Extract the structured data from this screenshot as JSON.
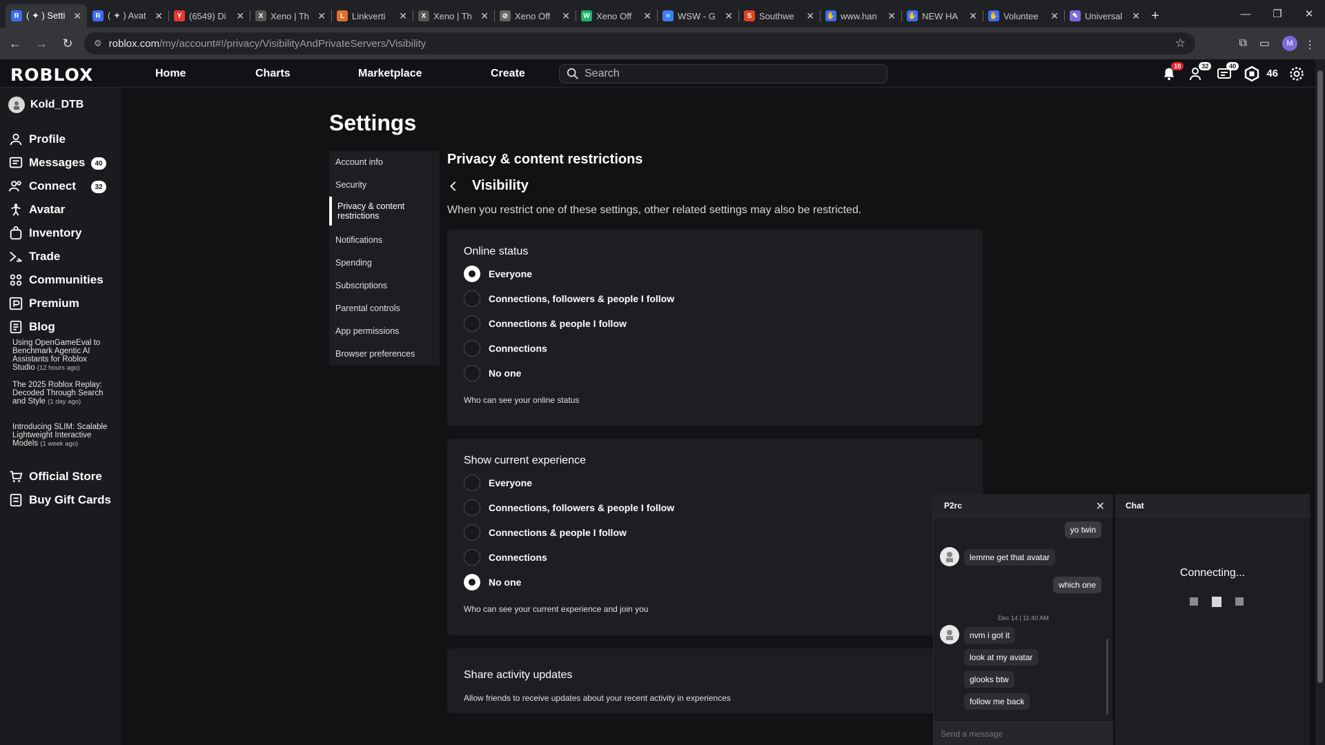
{
  "browser": {
    "tabs": [
      {
        "title": "( ✦ ) Setti",
        "color": "#3b6ef5",
        "glyph": "R"
      },
      {
        "title": "( ✦ ) Avat",
        "color": "#3b6ef5",
        "glyph": "R"
      },
      {
        "title": "(6549) Di",
        "color": "#e53935",
        "glyph": "Y"
      },
      {
        "title": "Xeno | Th",
        "color": "#555555",
        "glyph": "X"
      },
      {
        "title": "Linkverti",
        "color": "#e0702a",
        "glyph": "L"
      },
      {
        "title": "Xeno | Th",
        "color": "#555555",
        "glyph": "X"
      },
      {
        "title": "Xeno Off",
        "color": "#666666",
        "glyph": "⊘"
      },
      {
        "title": "Xeno Off",
        "color": "#20b26b",
        "glyph": "W"
      },
      {
        "title": "WSW - G",
        "color": "#3d7ef0",
        "glyph": "≡"
      },
      {
        "title": "Southwe",
        "color": "#e2431e",
        "glyph": "S"
      },
      {
        "title": "www.han",
        "color": "#3b6ef5",
        "glyph": "✋"
      },
      {
        "title": "NEW HA",
        "color": "#3b6ef5",
        "glyph": "✋"
      },
      {
        "title": "Voluntee",
        "color": "#3b6ef5",
        "glyph": "✋"
      },
      {
        "title": "Universal",
        "color": "#7d6bd8",
        "glyph": "✎"
      }
    ],
    "url_host": "roblox.com",
    "url_path": "/my/account#!/privacy/VisibilityAndPrivateServers/Visibility",
    "profile_initial": "M"
  },
  "header": {
    "logo": "ROBLOX",
    "nav": [
      "Home",
      "Charts",
      "Marketplace",
      "Create"
    ],
    "search_placeholder": "Search",
    "notifications": "10",
    "friends": "32",
    "messages": "40",
    "robux": "46"
  },
  "sidebar": {
    "username": "Kold_DTB",
    "items": [
      {
        "label": "Profile",
        "icon": "person-icon"
      },
      {
        "label": "Messages",
        "icon": "message-icon",
        "badge": "40"
      },
      {
        "label": "Connect",
        "icon": "people-icon",
        "badge": "32"
      },
      {
        "label": "Avatar",
        "icon": "avatar-icon"
      },
      {
        "label": "Inventory",
        "icon": "bag-icon"
      },
      {
        "label": "Trade",
        "icon": "trade-icon"
      },
      {
        "label": "Communities",
        "icon": "communities-icon"
      },
      {
        "label": "Premium",
        "icon": "premium-icon"
      },
      {
        "label": "Blog",
        "icon": "blog-icon"
      }
    ],
    "blog_posts": [
      {
        "title": "Using OpenGameEval to Benchmark Agentic AI Assistants for Roblox Studio",
        "age": "(12 hours ago)"
      },
      {
        "title": "The 2025 Roblox Replay: Decoded Through Search and Style",
        "age": "(1 day ago)"
      },
      {
        "title": "Introducing SLIM: Scalable Lightweight Interactive Models",
        "age": "(1 week ago)"
      }
    ],
    "store": "Official Store",
    "giftcards": "Buy Gift Cards"
  },
  "settings": {
    "title": "Settings",
    "nav": [
      "Account info",
      "Security",
      "Privacy & content restrictions",
      "Notifications",
      "Spending",
      "Subscriptions",
      "Parental controls",
      "App permissions",
      "Browser preferences"
    ],
    "section_title": "Privacy & content restrictions",
    "subsection": "Visibility",
    "description": "When you restrict one of these settings, other related settings may also be restricted.",
    "online": {
      "title": "Online status",
      "options": [
        "Everyone",
        "Connections, followers & people I follow",
        "Connections & people I follow",
        "Connections",
        "No one"
      ],
      "hint": "Who can see your online status"
    },
    "experience": {
      "title": "Show current experience",
      "options": [
        "Everyone",
        "Connections, followers & people I follow",
        "Connections & people I follow",
        "Connections",
        "No one"
      ],
      "hint": "Who can see your current experience and join you"
    },
    "activity": {
      "title": "Share activity updates",
      "hint": "Allow friends to receive updates about your recent activity in experiences"
    }
  },
  "chat": {
    "contact": "P2rc",
    "messages": [
      "yo twin",
      "lemme get that avatar",
      "which one",
      "nvm i got it",
      "look at my avatar",
      "glooks btw",
      "follow me back"
    ],
    "timestamp": "Dec 14 | 11:40 AM",
    "input_placeholder": "Send a message",
    "panel_title": "Chat",
    "status": "Connecting..."
  }
}
